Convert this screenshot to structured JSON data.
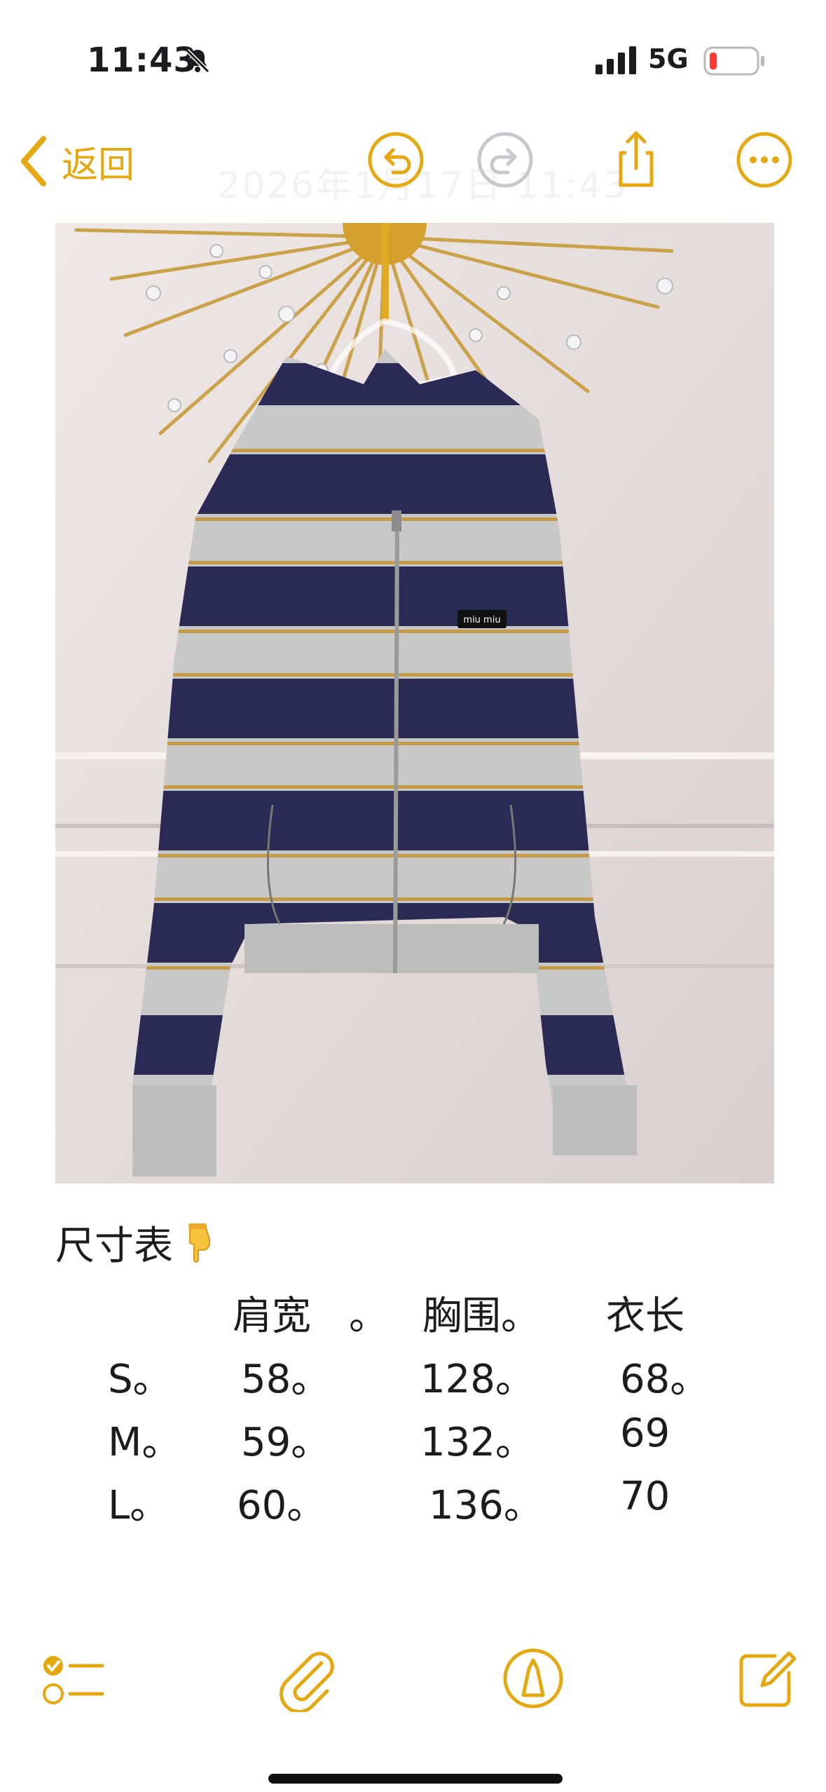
{
  "status_bar": {
    "time": "11:43",
    "network": "5G",
    "icons": [
      "bell-slash-icon",
      "signal-icon",
      "battery-icon"
    ]
  },
  "nav": {
    "back_label": "返回",
    "faded_date": "2026年1月17日 11:43",
    "icons": [
      "chevron-left-icon",
      "undo-icon",
      "redo-icon",
      "share-icon",
      "more-icon"
    ]
  },
  "photo": {
    "tag_text": "miu miu"
  },
  "note": {
    "heading": "尺寸表",
    "heading_emoji": "pointing-down-icon",
    "header_row": [
      "肩宽",
      "。",
      "胸围。",
      "衣长"
    ],
    "rows": [
      [
        "S。",
        "58。",
        "128。",
        "68。"
      ],
      [
        "M。",
        "59。",
        "132。",
        "69"
      ],
      [
        "L。",
        "60。",
        "136。",
        "70"
      ]
    ]
  },
  "toolbar": {
    "icons": [
      "checklist-icon",
      "paperclip-icon",
      "markup-pen-icon",
      "compose-icon"
    ]
  },
  "colors": {
    "accent": "#e4a910",
    "disabled": "#c7c7cc",
    "battery_low": "#ff3b30"
  }
}
